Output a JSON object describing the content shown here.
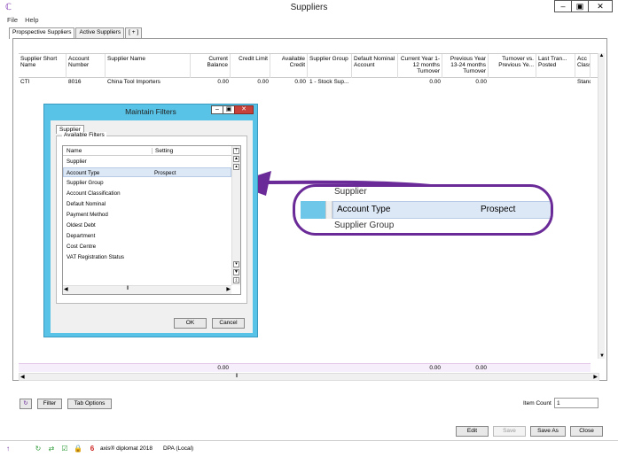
{
  "window": {
    "title": "Suppliers"
  },
  "menu": [
    "File",
    "Help"
  ],
  "tabs": [
    "Propspective Suppliers",
    "Active Suppliers",
    "[ + ]"
  ],
  "grid": {
    "columns": [
      "Supplier Short Name",
      "Account Number",
      "Supplier Name",
      "Current Balance",
      "Credit Limit",
      "Available Credit",
      "Supplier Group",
      "Default Nominal Account",
      "Current Year 1-12 months Turnover",
      "Previous Year 13-24 months Turnover",
      "Turnover vs. Previous Ye...",
      "Last Tran... Posted",
      "Acc Class"
    ],
    "rows": [
      [
        "CTI",
        "8016",
        "China Tool Importers",
        "0.00",
        "0.00",
        "0.00",
        "1 - Stock Sup...",
        "",
        "0.00",
        "0.00",
        "",
        "",
        "Stand"
      ]
    ],
    "totals": {
      "balance": "0.00",
      "current_year": "0.00",
      "previous_year": "0.00"
    }
  },
  "controls": {
    "filter": "Filter",
    "tab_options": "Tab Options",
    "item_count_label": "Item Count",
    "item_count": "1",
    "edit": "Edit",
    "save": "Save",
    "save_as": "Save As",
    "close": "Close"
  },
  "status": {
    "app": "axis® diplomat 2018",
    "db": "DPA (Local)"
  },
  "dialog": {
    "title": "Maintain Filters",
    "tab": "Supplier",
    "group": "Available Filters",
    "headers": [
      "Name",
      "Setting"
    ],
    "rows": [
      {
        "name": "Supplier",
        "setting": ""
      },
      {
        "name": "Account Type",
        "setting": "Prospect"
      },
      {
        "name": "Supplier Group",
        "setting": ""
      },
      {
        "name": "Account Classification",
        "setting": ""
      },
      {
        "name": "Default Nominal",
        "setting": ""
      },
      {
        "name": "Payment Method",
        "setting": ""
      },
      {
        "name": "Oldest Debt",
        "setting": ""
      },
      {
        "name": "Department",
        "setting": ""
      },
      {
        "name": "Cost Centre",
        "setting": ""
      },
      {
        "name": "VAT Registration Status",
        "setting": ""
      }
    ],
    "ok": "OK",
    "cancel": "Cancel"
  },
  "zoom": {
    "above": "Supplier",
    "name": "Account Type",
    "setting": "Prospect",
    "below": "Supplier Group"
  },
  "colors": {
    "accent": "#6a2a97",
    "dialog_frame": "#58c3e6",
    "selection": "#dde8f6"
  }
}
